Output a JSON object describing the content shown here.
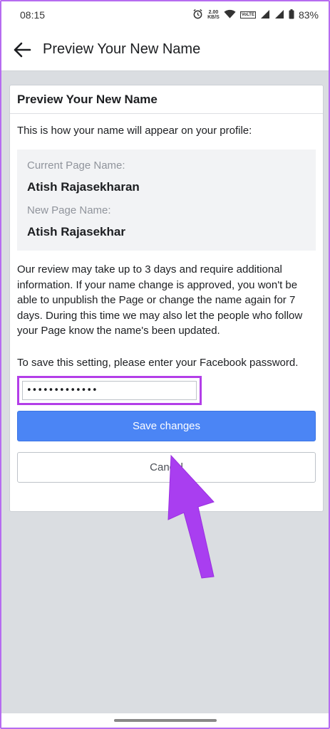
{
  "status_bar": {
    "time": "08:15",
    "net_speed_value": "2.00",
    "net_speed_unit": "KB/S",
    "volte": "VoLTE",
    "battery": "83%"
  },
  "header": {
    "title": "Preview Your New Name"
  },
  "card": {
    "title": "Preview Your New Name",
    "intro": "This is how your name will appear on your profile:",
    "current_label": "Current Page Name:",
    "current_value": "Atish Rajasekharan",
    "new_label": "New Page Name:",
    "new_value": "Atish Rajasekhar",
    "review_text": "Our review may take up to 3 days and require additional information. If your name change is approved, you won't be able to unpublish the Page or change the name again for 7 days. During this time we may also let the people who follow your Page know the name's been updated.",
    "save_note": "To save this setting, please enter your Facebook password.",
    "password_value": "•••••••••••••",
    "save_label": "Save changes",
    "cancel_label": "Cancel"
  },
  "colors": {
    "accent": "#4b85f5",
    "highlight": "#b33ee8",
    "arrow": "#a93ef0"
  }
}
